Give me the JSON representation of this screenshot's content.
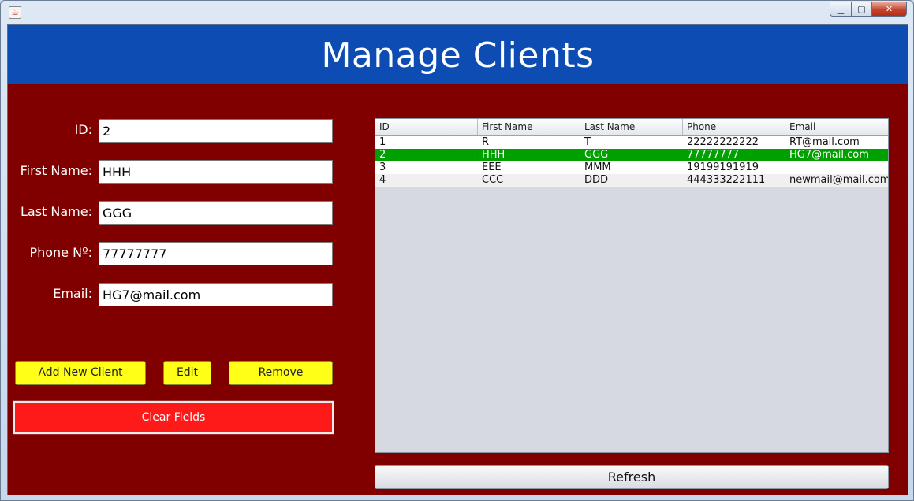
{
  "window": {
    "icon": "java-icon",
    "controls": {
      "minimize": "minimize-icon",
      "maximize": "maximize-icon",
      "close": "close-icon"
    }
  },
  "header": {
    "title": "Manage Clients"
  },
  "form": {
    "id": {
      "label": "ID:",
      "value": "2"
    },
    "first_name": {
      "label": "First Name:",
      "value": "HHH"
    },
    "last_name": {
      "label": "Last Name:",
      "value": "GGG"
    },
    "phone": {
      "label": "Phone Nº:",
      "value": "77777777"
    },
    "email": {
      "label": "Email:",
      "value": "HG7@mail.com"
    }
  },
  "buttons": {
    "add": "Add New Client",
    "edit": "Edit",
    "remove": "Remove",
    "clear": "Clear Fields",
    "refresh": "Refresh"
  },
  "table": {
    "columns": [
      "ID",
      "First Name",
      "Last Name",
      "Phone",
      "Email"
    ],
    "rows": [
      [
        "1",
        "R",
        "T",
        "22222222222",
        "RT@mail.com"
      ],
      [
        "2",
        "HHH",
        "GGG",
        "77777777",
        "HG7@mail.com"
      ],
      [
        "3",
        "EEE",
        "MMM",
        "19199191919",
        ""
      ],
      [
        "4",
        "CCC",
        "DDD",
        "444333222111",
        "newmail@mail.com"
      ]
    ],
    "selected_row": 1
  },
  "colors": {
    "header_bg": "#0c4cb3",
    "panel_bg": "#800000",
    "button_yellow": "#ffff17",
    "button_red": "#ff1a1a",
    "selected_row": "#00a000"
  }
}
